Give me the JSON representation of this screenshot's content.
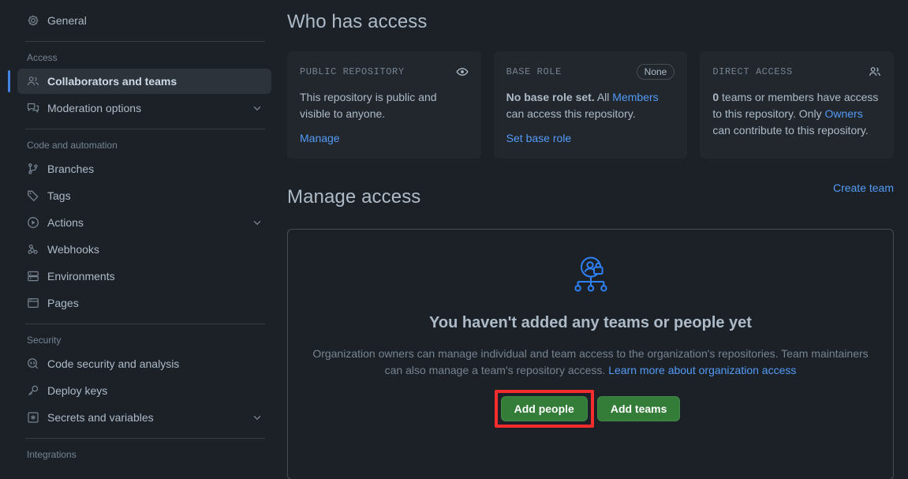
{
  "sidebar": {
    "top_items": [
      {
        "label": "General",
        "icon": "gear-icon",
        "chevron": false
      }
    ],
    "groups": [
      {
        "title": "Access",
        "items": [
          {
            "label": "Collaborators and teams",
            "icon": "people-icon",
            "chevron": false,
            "active": true
          },
          {
            "label": "Moderation options",
            "icon": "comment-discussion-icon",
            "chevron": true,
            "active": false
          }
        ]
      },
      {
        "title": "Code and automation",
        "items": [
          {
            "label": "Branches",
            "icon": "git-branch-icon",
            "chevron": false,
            "active": false
          },
          {
            "label": "Tags",
            "icon": "tag-icon",
            "chevron": false,
            "active": false
          },
          {
            "label": "Actions",
            "icon": "play-circle-icon",
            "chevron": true,
            "active": false
          },
          {
            "label": "Webhooks",
            "icon": "webhook-icon",
            "chevron": false,
            "active": false
          },
          {
            "label": "Environments",
            "icon": "server-icon",
            "chevron": false,
            "active": false
          },
          {
            "label": "Pages",
            "icon": "browser-icon",
            "chevron": false,
            "active": false
          }
        ]
      },
      {
        "title": "Security",
        "items": [
          {
            "label": "Code security and analysis",
            "icon": "codescan-icon",
            "chevron": false,
            "active": false
          },
          {
            "label": "Deploy keys",
            "icon": "key-icon",
            "chevron": false,
            "active": false
          },
          {
            "label": "Secrets and variables",
            "icon": "asterisk-box-icon",
            "chevron": true,
            "active": false
          }
        ]
      },
      {
        "title": "Integrations",
        "items": []
      }
    ]
  },
  "main": {
    "who_has_access_title": "Who has access",
    "cards": [
      {
        "kicker": "Public repository",
        "icon": "eye-icon",
        "badge": "",
        "body_html": "This repository is public and visible to anyone.",
        "link": "Manage"
      },
      {
        "kicker": "Base role",
        "icon": "",
        "badge": "None",
        "body_parts": {
          "bold": "No base role set.",
          "mid": " All ",
          "link": "Members",
          "tail": " can access this repository."
        },
        "link": "Set base role"
      },
      {
        "kicker": "Direct access",
        "icon": "people-icon",
        "badge": "",
        "body_parts": {
          "bold": "0",
          "mid": " teams or members have access to this repository. Only ",
          "link": "Owners",
          "tail": " can contribute to this repository."
        },
        "link": ""
      }
    ],
    "manage_access_title": "Manage access",
    "create_team_link": "Create team",
    "empty_state": {
      "illustration": "org-access-lock-illustration",
      "title": "You haven't added any teams or people yet",
      "description_lead": "Organization owners can manage individual and team access to the organization's repositories. Team maintainers can also manage a team's repository access. ",
      "description_link": "Learn more about organization access",
      "primary_button": "Add people",
      "secondary_button": "Add teams"
    }
  },
  "annotation": {
    "highlight_target": "Add people",
    "highlight_color": "#f62d2d"
  }
}
